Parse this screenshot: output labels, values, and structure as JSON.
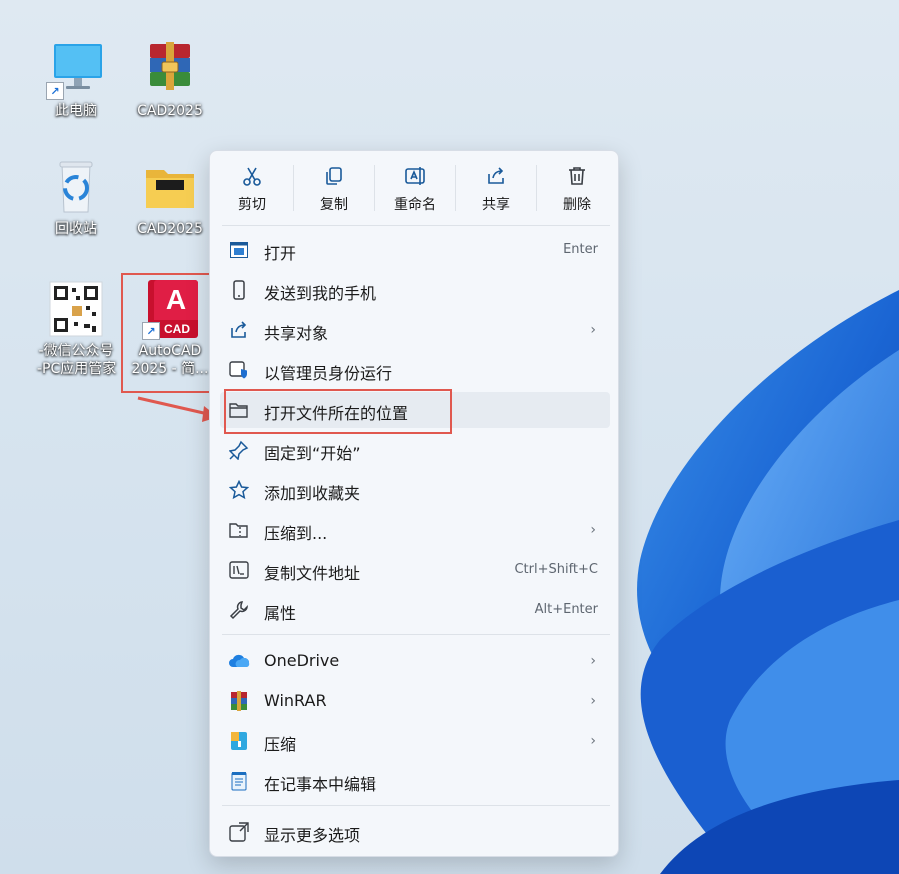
{
  "desktop": {
    "icons": [
      {
        "label": "此电脑",
        "icon": "computer-icon"
      },
      {
        "label": "CAD2025",
        "icon": "winrar-archive-icon"
      },
      {
        "label": "回收站",
        "icon": "recycle-bin-icon"
      },
      {
        "label": "CAD2025",
        "icon": "folder-icon"
      },
      {
        "label_line1": "-微信公众号",
        "label_line2": "-PC应用管家",
        "icon": "qr-code-icon"
      },
      {
        "label_line1": "AutoCAD",
        "label_line2": "2025 - 简...",
        "icon": "autocad-icon",
        "badge": "CAD",
        "letter": "A"
      }
    ]
  },
  "context_menu": {
    "quick_actions": [
      {
        "label": "剪切",
        "icon": "cut-icon"
      },
      {
        "label": "复制",
        "icon": "copy-icon"
      },
      {
        "label": "重命名",
        "icon": "rename-icon"
      },
      {
        "label": "共享",
        "icon": "share-icon"
      },
      {
        "label": "删除",
        "icon": "delete-icon"
      }
    ],
    "items": [
      {
        "label": "打开",
        "shortcut": "Enter",
        "icon": "open-icon"
      },
      {
        "label": "发送到我的手机",
        "icon": "phone-icon"
      },
      {
        "label": "共享对象",
        "icon": "share-with-icon",
        "submenu": true
      },
      {
        "label": "以管理员身份运行",
        "icon": "admin-shield-icon"
      },
      {
        "label": "打开文件所在的位置",
        "icon": "folder-open-icon",
        "highlighted": true
      },
      {
        "label": "固定到“开始”",
        "icon": "pin-icon"
      },
      {
        "label": "添加到收藏夹",
        "icon": "star-icon"
      },
      {
        "label": "压缩到...",
        "icon": "zip-folder-icon",
        "submenu": true
      },
      {
        "label": "复制文件地址",
        "shortcut": "Ctrl+Shift+C",
        "icon": "copy-path-icon"
      },
      {
        "label": "属性",
        "shortcut": "Alt+Enter",
        "icon": "wrench-icon"
      }
    ],
    "items2": [
      {
        "label": "OneDrive",
        "icon": "onedrive-icon",
        "submenu": true
      },
      {
        "label": "WinRAR",
        "icon": "winrar-icon",
        "submenu": true
      },
      {
        "label": "压缩",
        "icon": "compress-icon",
        "submenu": true
      },
      {
        "label": "在记事本中编辑",
        "icon": "notepad-icon"
      }
    ],
    "items3": [
      {
        "label": "显示更多选项",
        "icon": "show-more-icon"
      }
    ],
    "chevron": "›"
  },
  "colors": {
    "accent": "#0067c0",
    "annotation_red": "#e0584f"
  }
}
